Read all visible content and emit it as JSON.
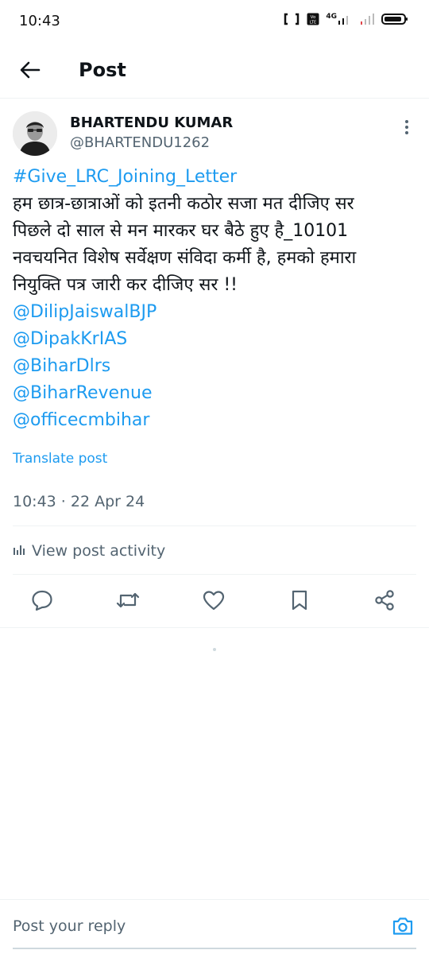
{
  "status_bar": {
    "time": "10:43",
    "network_label": "4G"
  },
  "header": {
    "title": "Post",
    "back_icon": "arrow-left-icon"
  },
  "author": {
    "name": "BHARTENDU KUMAR",
    "handle": "@BHARTENDU1262",
    "avatar_icon": "avatar-photo"
  },
  "post": {
    "hashtag": "#Give_LRC_Joining_Letter",
    "lines": [
      "हम छात्र-छात्राओं को इतनी कठोर सजा मत दीजिए सर",
      "पिछले दो साल से मन मारकर घर बैठे हुए है_10101",
      "नवचयनित विशेष सर्वेक्षण संविदा कर्मी है, हमको हमारा",
      "नियुक्ति पत्र जारी कर दीजिए सर !!"
    ],
    "mentions": [
      "@DilipJaiswalBJP",
      "@DipakKrIAS",
      "@BiharDlrs",
      "@BiharRevenue",
      "@officecmbihar"
    ],
    "translate_label": "Translate post",
    "timestamp": "10:43 · 22 Apr 24"
  },
  "activity": {
    "label": "View post activity",
    "icon": "bar-chart-icon"
  },
  "actions": [
    {
      "name": "reply",
      "icon": "reply-icon"
    },
    {
      "name": "repost",
      "icon": "repost-icon"
    },
    {
      "name": "like",
      "icon": "heart-icon"
    },
    {
      "name": "bookmark",
      "icon": "bookmark-icon"
    },
    {
      "name": "share",
      "icon": "share-icon"
    }
  ],
  "reply_bar": {
    "placeholder": "Post your reply",
    "camera_icon": "camera-icon"
  },
  "colors": {
    "accent": "#1d9bf0",
    "text": "#0f1419",
    "muted": "#536471",
    "divider": "#eff3f4"
  }
}
